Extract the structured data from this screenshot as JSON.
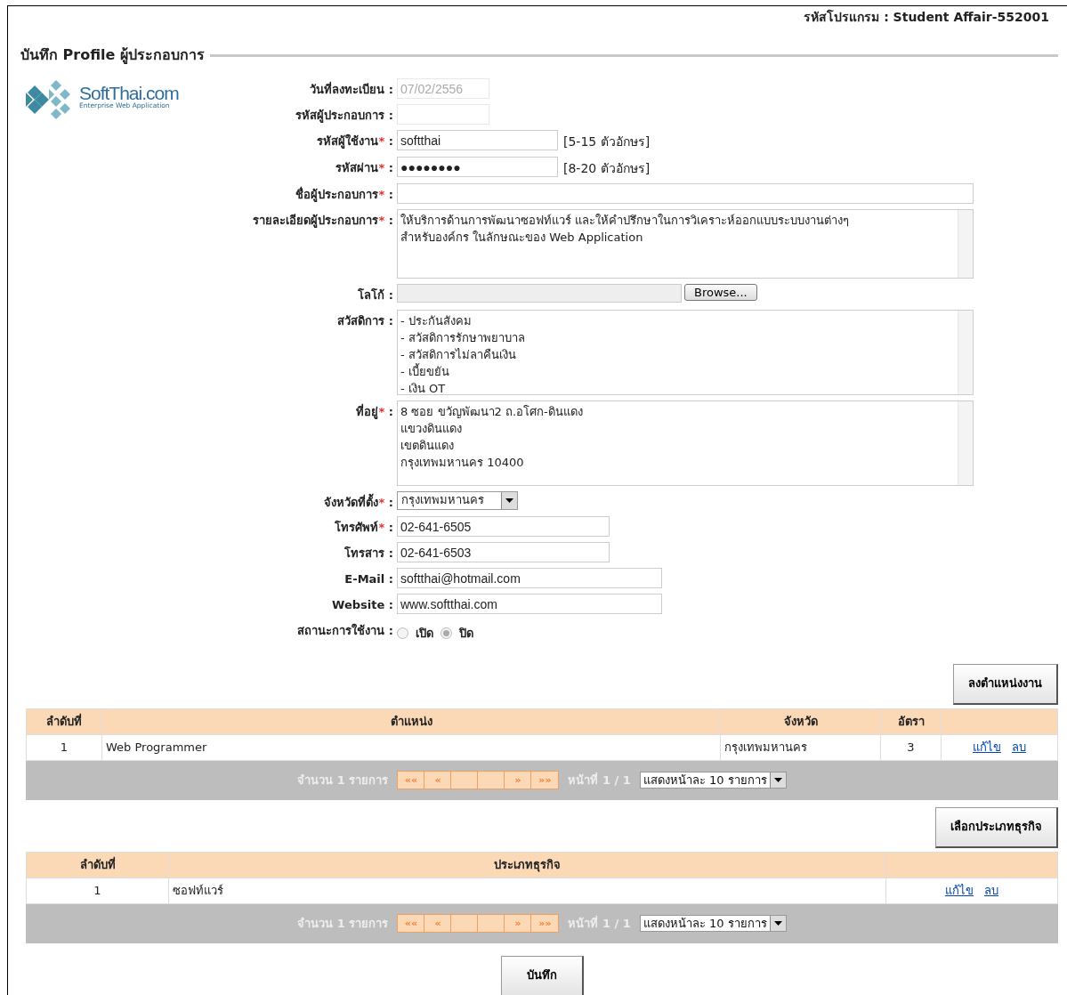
{
  "program_code": "รหัสโปรแกรม : Student Affair-552001",
  "title": "บันทึก Profile ผู้ประกอบการ",
  "logo": {
    "name": "SoftThai.com",
    "tagline": "Enterprise Web Application"
  },
  "fields": [
    {
      "kind": "text",
      "label": "วันที่ลงทะเบียน",
      "colon": ":",
      "value": "07/02/2556",
      "disabled": true
    },
    {
      "kind": "text",
      "label": "รหัสผู้ประกอบการ",
      "colon": ":",
      "disabled": true
    },
    {
      "kind": "text",
      "label": "รหัสผู้ใช้งาน",
      "required_mark": "*",
      "colon": ":",
      "value": "softthai",
      "hint": "[5-15 ตัวอักษร]",
      "disabled": false
    },
    {
      "kind": "text",
      "label": "รหัสผ่าน",
      "required_mark": "*",
      "colon": ":",
      "value": "●●●●●●●●",
      "hint": "[8-20 ตัวอักษร]",
      "disabled": false
    },
    {
      "kind": "text",
      "label": "ชื่อผู้ประกอบการ",
      "required_mark": "*",
      "colon": ":",
      "disabled": false
    },
    {
      "kind": "textarea",
      "label": "รายละเอียดผู้ประกอบการ",
      "required_mark": "*",
      "colon": ":",
      "lines": [
        "ให้บริการด้านการพัฒนาซอฟท์แวร์ และให้คำปรึกษาในการวิเคราะห์ออกแบบระบบงานต่างๆ",
        "สำหรับองค์กร ในลักษณะของ Web Application"
      ]
    },
    {
      "kind": "file",
      "label": "โลโก้",
      "colon": ":",
      "button": "Browse..."
    },
    {
      "kind": "textarea",
      "label": "สวัสดิการ",
      "colon": ":",
      "lines": [
        "-  ประกันสังคม",
        "-  สวัสดิการรักษาพยาบาล",
        "-  สวัสดิการไม่ลาคืนเงิน",
        "-  เบี้ยขยัน",
        "-  เงิน OT"
      ]
    },
    {
      "kind": "textarea",
      "label": "ที่อยู่",
      "required_mark": "*",
      "colon": ":",
      "lines": [
        "8  ซอย ขวัญพัฒนา2  ถ.อโศก-ดินแดง",
        "แขวงดินแดง",
        "เขตดินแดง",
        "กรุงเทพมหานคร 10400"
      ]
    },
    {
      "kind": "select",
      "label": "จังหวัดที่ตั้ง",
      "required_mark": "*",
      "colon": ":",
      "value": "กรุงเทพมหานคร"
    },
    {
      "kind": "text",
      "label": "โทรศัพท์",
      "required_mark": "*",
      "colon": ":",
      "value": "02-641-6505",
      "disabled": false
    },
    {
      "kind": "text",
      "label": "โทรสาร",
      "colon": ":",
      "value": "02-641-6503",
      "disabled": false
    },
    {
      "kind": "text",
      "label": "E-Mail",
      "colon": ":",
      "value": "softthai@hotmail.com",
      "disabled": false
    },
    {
      "kind": "text",
      "label": "Website",
      "colon": ":",
      "value": "www.softthai.com",
      "disabled": false
    },
    {
      "kind": "radio",
      "label": "สถานะการใช้งาน",
      "colon": ":",
      "options": [
        {
          "label": "เปิด",
          "selected": false
        },
        {
          "label": "ปิด",
          "selected": true
        }
      ]
    }
  ],
  "tables": [
    {
      "button": "ลงตำแหน่งงาน",
      "columns": [
        "ลำดับที่",
        "ตำแหน่ง",
        "จังหวัด",
        "อัตรา"
      ],
      "rows": [
        {
          "cells": [
            "1",
            "Web Programmer",
            "กรุงเทพมหานคร",
            "3"
          ],
          "actions": [
            "แก้ไข",
            "ลบ"
          ]
        }
      ],
      "pager": {
        "count": "จำนวน 1 รายการ",
        "first": "««",
        "prev": "«",
        "next": "»",
        "last": "»»",
        "page": "หน้าที่ 1 / 1",
        "page_size": "แสดงหน้าละ 10 รายการ"
      }
    },
    {
      "button": "เลือกประเภทธุรกิจ",
      "columns": [
        "ลำดับที่",
        "ประเภทธุรกิจ"
      ],
      "rows": [
        {
          "cells": [
            "1",
            "ซอฟท์แวร์"
          ],
          "actions": [
            "แก้ไข",
            "ลบ"
          ]
        }
      ],
      "pager": {
        "count": "จำนวน 1 รายการ",
        "first": "««",
        "prev": "«",
        "next": "»",
        "last": "»»",
        "page": "หน้าที่ 1 / 1",
        "page_size": "แสดงหน้าละ 10 รายการ"
      }
    }
  ],
  "save_button": "บันทึก"
}
